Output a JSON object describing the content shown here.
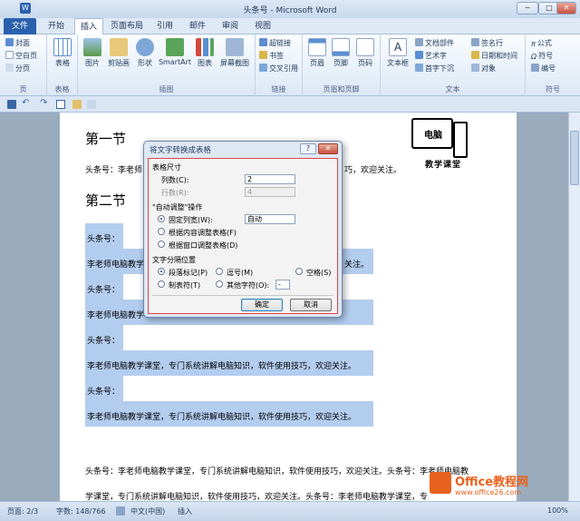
{
  "window": {
    "title": "头条号 - Microsoft Word",
    "minimize": "─",
    "maximize": "□",
    "close": "✕"
  },
  "tabs": [
    "文件",
    "开始",
    "插入",
    "页面布局",
    "引用",
    "邮件",
    "审阅",
    "视图"
  ],
  "ribbon": {
    "pages": {
      "label": "页",
      "items": [
        "封面",
        "空白页",
        "分页"
      ]
    },
    "table": {
      "label": "表格",
      "item": "表格"
    },
    "illustrations": {
      "label": "插图",
      "items": [
        "图片",
        "剪贴画",
        "形状",
        "SmartArt",
        "图表",
        "屏幕截图"
      ]
    },
    "links": {
      "label": "链接",
      "items": [
        "超链接",
        "书签",
        "交叉引用"
      ]
    },
    "header_footer": {
      "label": "页眉和页脚",
      "items": [
        "页眉",
        "页脚",
        "页码"
      ]
    },
    "text": {
      "label": "文本",
      "items": [
        "文本框",
        "文档部件",
        "艺术字",
        "首字下沉",
        "签名行",
        "日期和时间",
        "对象"
      ]
    },
    "symbols": {
      "label": "符号",
      "items": [
        "公式",
        "符号",
        "编号"
      ]
    }
  },
  "document": {
    "h1": "第一节",
    "h2": "第二节",
    "line1_prefix": "头条号：李老师",
    "line1_suffix": "巧，欢迎关注。",
    "logo_top": "电脑",
    "logo_bottom": "教学课堂",
    "rows": [
      {
        "label": "头条号："
      },
      {
        "text": "李老师电脑教学",
        "suffix": "关注。"
      },
      {
        "label": "头条号："
      },
      {
        "text": "李老师电脑教学"
      },
      {
        "label": "头条号："
      },
      {
        "text": "李老师电脑教学课堂，专门系统讲解电脑知识，软件使用技巧，欢迎关注。"
      },
      {
        "label": "头条号："
      },
      {
        "text": "李老师电脑教学课堂，专门系统讲解电脑知识，软件使用技巧，欢迎关注。"
      }
    ],
    "para1": "头条号：李老师电脑教学课堂，专门系统讲解电脑知识，软件使用技巧，欢迎关注。头条号：李老师电脑教",
    "para2": "学课堂，专门系统讲解电脑知识，软件使用技巧，欢迎关注。头条号：李老师电脑教学课堂，专",
    "watermark": {
      "brand": "Office教程网",
      "url": "www.office26.com"
    }
  },
  "dialog": {
    "title": "将文字转换成表格",
    "help": "?",
    "close": "✕",
    "table_size": "表格尺寸",
    "cols_label": "列数(C):",
    "cols_value": "2",
    "rows_label": "行数(R):",
    "rows_value": "4",
    "autofit_label": "\"自动调整\"操作",
    "fixed_width": "固定列宽(W):",
    "fixed_value": "自动",
    "fit_content": "根据内容调整表格(F)",
    "fit_window": "根据窗口调整表格(D)",
    "separator_label": "文字分隔位置",
    "paragraph": "段落标记(P)",
    "comma": "逗号(M)",
    "space": "空格(S)",
    "tab": "制表符(T)",
    "other": "其他字符(O):",
    "other_value": "-",
    "ok": "确定",
    "cancel": "取消"
  },
  "status": {
    "page": "页面: 2/3",
    "words": "字数: 148/766",
    "lang": "中文(中国)",
    "mode": "插入",
    "zoom": "100%"
  }
}
